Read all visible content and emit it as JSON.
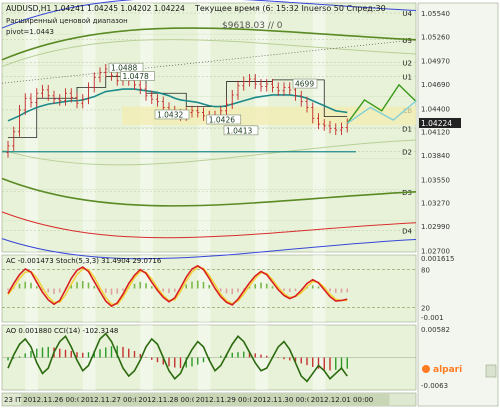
{
  "header": {
    "symbol_line": "AUDUSD,H1  1.04241  1.04245  1.04202  1.04224",
    "server_time": "Текущее время (6: 15:32 Inuerso 50 Спред:30",
    "pivot_name": "Расширенный ценовой диапазон",
    "pivot_value": "pivot=1.0443",
    "balance_line": "$9618.03      // 0"
  },
  "colors": {
    "background": "#ffffff",
    "pane_bg": "#e8f2d8",
    "grid": "#d4e3c2",
    "price_bar": "#c4282a",
    "ema_teal": "#1c8a8a",
    "band_green": "#5a8a24",
    "band_blue": "#3546d8",
    "band_red": "#d92d2d",
    "stoch_main": "#d92020",
    "stoch_signal": "#f2d030",
    "cci_line": "#2c6a10",
    "ao_up": "#2a9a2a",
    "ao_down": "#c43030",
    "brand": "#ff7a20"
  },
  "chart_data": [
    {
      "type": "line",
      "pane": "main",
      "series_count": 10,
      "price_labels": [
        "1.05540",
        "1.05260",
        "1.04970",
        "1.04690",
        "1.04400",
        "1.04224",
        "1.04120",
        "1.03840",
        "1.03550",
        "1.03270",
        "1.02990",
        "1.02700"
      ],
      "pivot_levels": [
        {
          "name": "U4",
          "price": 1.0554
        },
        {
          "name": "U3",
          "price": 1.0522
        },
        {
          "name": "U2",
          "price": 1.0495
        },
        {
          "name": "U1",
          "price": 1.0478
        },
        {
          "name": "LB",
          "price": 1.0438
        },
        {
          "name": "D1",
          "price": 1.0416
        },
        {
          "name": "D2",
          "price": 1.0388
        },
        {
          "name": "D3",
          "price": 1.034
        },
        {
          "name": "D4",
          "price": 1.0294
        }
      ],
      "annotations": [
        {
          "text": "1.0488",
          "price": 1.0488
        },
        {
          "text": "1.0478",
          "price": 1.0478
        },
        {
          "text": "1.0432",
          "price": 1.0432
        },
        {
          "text": "1.0426",
          "price": 1.0426
        },
        {
          "text": "1.0413",
          "price": 1.0413
        },
        {
          "text": "4699",
          "price": 1.0469
        }
      ],
      "current_price": "1.04224",
      "current_price_value": 1.04224,
      "ylim": [
        1.0268,
        1.0566
      ],
      "closes": [
        1.0395,
        1.0412,
        1.0438,
        1.0452,
        1.0447,
        1.0458,
        1.0462,
        1.0455,
        1.0451,
        1.0449,
        1.0458,
        1.0453,
        1.0446,
        1.0451,
        1.0465,
        1.0477,
        1.0483,
        1.0487,
        1.0479,
        1.0473,
        1.0478,
        1.0473,
        1.0468,
        1.0463,
        1.0455,
        1.0451,
        1.0448,
        1.0441,
        1.0437,
        1.0433,
        1.0431,
        1.0435,
        1.0437,
        1.0435,
        1.0431,
        1.0427,
        1.0431,
        1.0437,
        1.0445,
        1.0456,
        1.0467,
        1.0472,
        1.0475,
        1.0469,
        1.0466,
        1.0469,
        1.0465,
        1.0461,
        1.0465,
        1.0462,
        1.0455,
        1.0448,
        1.0441,
        1.0428,
        1.0421,
        1.0419,
        1.0416,
        1.0414,
        1.0417,
        1.0422
      ],
      "ema": [
        1.0425,
        1.0428,
        1.0431,
        1.0435,
        1.0438,
        1.0441,
        1.0443,
        1.0445,
        1.0446,
        1.0447,
        1.0448,
        1.0449,
        1.0449,
        1.045,
        1.0452,
        1.0454,
        1.0457,
        1.046,
        1.0461,
        1.0462,
        1.0463,
        1.0463,
        1.0463,
        1.0462,
        1.0461,
        1.046,
        1.0459,
        1.0457,
        1.0455,
        1.0452,
        1.045,
        1.0449,
        1.0448,
        1.0447,
        1.0445,
        1.0443,
        1.0442,
        1.0442,
        1.0443,
        1.0445,
        1.0447,
        1.0449,
        1.0451,
        1.0453,
        1.0454,
        1.0455,
        1.0456,
        1.0456,
        1.0456,
        1.0456,
        1.0455,
        1.0454,
        1.0452,
        1.0449,
        1.0446,
        1.0443,
        1.044,
        1.0437,
        1.0436,
        1.0435
      ],
      "forecast": [
        {
          "path": [
            [
              59,
              1.0422
            ],
            [
              62,
              1.045
            ],
            [
              65,
              1.0437
            ],
            [
              68,
              1.0468
            ],
            [
              71,
              1.0448
            ]
          ]
        },
        {
          "path": [
            [
              59,
              1.0422
            ],
            [
              63,
              1.0441
            ],
            [
              67,
              1.0426
            ],
            [
              71,
              1.0449
            ]
          ]
        }
      ],
      "x_labels": [
        "23 IT",
        "2012.11.26 00:00",
        "2012.11.27 00:00",
        "2012.11.28 00:00",
        "2012.11.29 00:00",
        "2012.11.30 00:00",
        "2012.12.01 00:00"
      ]
    },
    {
      "type": "line",
      "pane": "oscillator",
      "title": "AC -0.001473  Stoch(5,3,3) 31.4904 29.0716",
      "labels": [
        "0.001615",
        "80",
        "20",
        "-0.001"
      ],
      "ylim": [
        0,
        100
      ],
      "levels": [
        20,
        80
      ],
      "stoch_main": [
        42,
        58,
        72,
        81,
        76,
        60,
        44,
        32,
        25,
        31,
        48,
        66,
        79,
        84,
        77,
        61,
        45,
        30,
        22,
        27,
        41,
        58,
        71,
        80,
        74,
        60,
        47,
        36,
        29,
        35,
        51,
        68,
        81,
        86,
        80,
        66,
        50,
        37,
        28,
        24,
        33,
        46,
        59,
        70,
        77,
        72,
        60,
        48,
        39,
        34,
        38,
        47,
        58,
        64,
        59,
        48,
        37,
        30,
        31,
        33
      ],
      "stoch_signal": [
        40,
        52,
        66,
        76,
        77,
        67,
        51,
        37,
        28,
        28,
        40,
        57,
        72,
        81,
        80,
        68,
        51,
        36,
        25,
        25,
        36,
        52,
        67,
        77,
        76,
        65,
        51,
        39,
        31,
        32,
        45,
        62,
        76,
        84,
        82,
        71,
        56,
        41,
        31,
        26,
        30,
        41,
        54,
        66,
        75,
        74,
        64,
        52,
        42,
        36,
        37,
        43,
        53,
        61,
        60,
        52,
        41,
        33,
        31,
        31
      ]
    },
    {
      "type": "bar",
      "pane": "ao",
      "title": "AO 0.001880  CCI(14) -102.3148",
      "labels": [
        "0.00582",
        "-0.0063"
      ],
      "ylim": [
        -100,
        100
      ],
      "ao": [
        -10,
        -4,
        4,
        14,
        22,
        30,
        34,
        36,
        34,
        30,
        26,
        22,
        18,
        16,
        18,
        22,
        28,
        34,
        38,
        40,
        36,
        30,
        22,
        12,
        2,
        -8,
        -16,
        -24,
        -30,
        -34,
        -36,
        -34,
        -30,
        -24,
        -16,
        -8,
        0,
        6,
        12,
        16,
        18,
        20,
        18,
        14,
        10,
        6,
        2,
        -2,
        -6,
        -10,
        -14,
        -20,
        -26,
        -32,
        -38,
        -42,
        -44,
        -42,
        -40,
        -38
      ],
      "cci": [
        -40,
        10,
        50,
        70,
        40,
        -20,
        -60,
        -40,
        20,
        60,
        80,
        40,
        -10,
        -50,
        -30,
        20,
        70,
        90,
        60,
        10,
        -40,
        -70,
        -50,
        -10,
        40,
        70,
        50,
        0,
        -50,
        -80,
        -60,
        -10,
        30,
        60,
        40,
        -10,
        -50,
        -30,
        10,
        50,
        80,
        60,
        20,
        -20,
        -50,
        -40,
        0,
        40,
        60,
        30,
        -20,
        -70,
        -90,
        -60,
        -30,
        -50,
        -80,
        -60,
        -40,
        -70
      ]
    }
  ],
  "brand": "alpari",
  "scrollbar": {
    "label": ""
  }
}
